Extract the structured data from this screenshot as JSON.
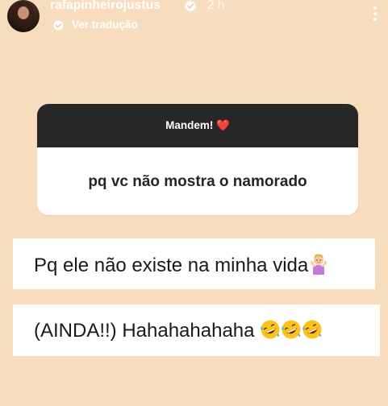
{
  "header": {
    "username": "rafapinheirojustus",
    "time": "2 h",
    "translate_label": "Ver tradução"
  },
  "question_sticker": {
    "prompt": "Mandem! ❤️",
    "question": "pq vc não mostra o namorado"
  },
  "responses": [
    {
      "text": "Pq ele não existe na minha vida",
      "emoji": "shrug-emoji"
    },
    {
      "text": "(AINDA!!) Hahahahahaha",
      "emoji": "rofl-emoji x3"
    }
  ],
  "colors": {
    "background": "#f8dcbe",
    "sticker_header": "#272727",
    "card": "#ffffff",
    "heart": "#e0245e"
  }
}
